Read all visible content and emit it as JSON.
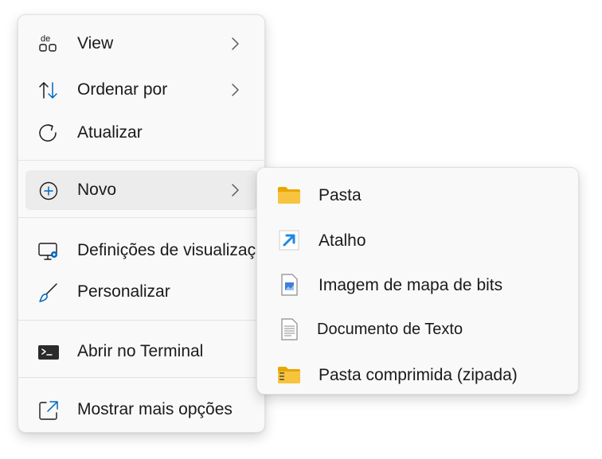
{
  "context_menu": {
    "items": [
      {
        "label": "View",
        "icon": "view-icon",
        "has_submenu": true
      },
      {
        "label": "Ordenar por",
        "icon": "sort-icon",
        "has_submenu": true
      },
      {
        "label": "Atualizar",
        "icon": "refresh-icon",
        "has_submenu": false
      },
      {
        "label": "Novo",
        "icon": "new-icon",
        "has_submenu": true,
        "active": true
      },
      {
        "label": "Definições de visualização",
        "icon": "display-settings-icon",
        "has_submenu": false
      },
      {
        "label": "Personalizar",
        "icon": "brush-icon",
        "has_submenu": false
      },
      {
        "label": "Abrir no Terminal",
        "icon": "terminal-icon",
        "has_submenu": false
      },
      {
        "label": "Mostrar mais opções",
        "icon": "more-options-icon",
        "has_submenu": false
      }
    ],
    "view_icon_text": "de"
  },
  "new_submenu": {
    "items": [
      {
        "label": "Pasta",
        "icon": "folder-icon"
      },
      {
        "label": "Atalho",
        "icon": "shortcut-icon"
      },
      {
        "label": "Imagem de mapa de bits",
        "icon": "bitmap-icon"
      },
      {
        "label": "Documento de Texto",
        "icon": "text-document-icon"
      },
      {
        "label": "Pasta comprimida (zipada)",
        "icon": "zip-folder-icon"
      }
    ]
  },
  "colors": {
    "accent": "#0067c0",
    "folder": "#f8c43f",
    "menu_background": "#f9f9f9",
    "active_item": "#ececec"
  }
}
